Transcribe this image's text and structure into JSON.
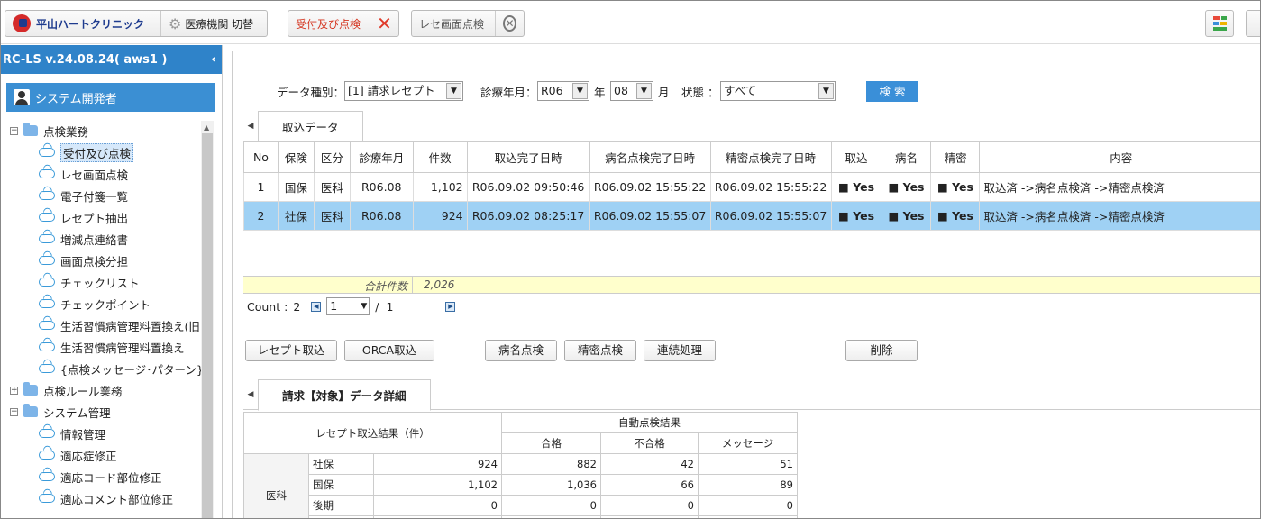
{
  "toolbar": {
    "clinic_name": "平山ハートクリニック",
    "switch_label": "医療機関 切替",
    "reception_label": "受付及び点検",
    "screen_check_label": "レセ画面点検"
  },
  "sidebar": {
    "version": "RC-LS v.24.08.24( aws1 )",
    "user": "システム開発者",
    "tree": [
      {
        "label": "点検業務",
        "type": "folder",
        "expander": "−",
        "level": 0
      },
      {
        "label": "受付及び点検",
        "type": "leaf",
        "level": 1,
        "selected": true
      },
      {
        "label": "レセ画面点検",
        "type": "leaf",
        "level": 1
      },
      {
        "label": "電子付箋一覧",
        "type": "leaf",
        "level": 1
      },
      {
        "label": "レセプト抽出",
        "type": "leaf",
        "level": 1
      },
      {
        "label": "増減点連絡書",
        "type": "leaf",
        "level": 1
      },
      {
        "label": "画面点検分担",
        "type": "leaf",
        "level": 1
      },
      {
        "label": "チェックリスト",
        "type": "leaf",
        "level": 1
      },
      {
        "label": "チェックポイント",
        "type": "leaf",
        "level": 1
      },
      {
        "label": "生活習慣病管理料置換え(旧.I",
        "type": "leaf",
        "level": 1
      },
      {
        "label": "生活習慣病管理料置換え",
        "type": "leaf",
        "level": 1
      },
      {
        "label": "{点検メッセージ･パターン}",
        "type": "leaf",
        "level": 1
      },
      {
        "label": "点検ルール業務",
        "type": "folder",
        "expander": "+",
        "level": 0
      },
      {
        "label": "システム管理",
        "type": "folder",
        "expander": "−",
        "level": 0
      },
      {
        "label": "情報管理",
        "type": "leaf",
        "level": 1
      },
      {
        "label": "適応症修正",
        "type": "leaf",
        "level": 1
      },
      {
        "label": "適応コード部位修正",
        "type": "leaf",
        "level": 1
      },
      {
        "label": "適応コメント部位修正",
        "type": "leaf",
        "level": 1
      }
    ]
  },
  "filter": {
    "data_type_label": "データ種別：",
    "data_type_value": "[1] 請求レセプト",
    "month_label": "診療年月：",
    "era_value": "R06",
    "year_suffix": "年",
    "month_value": "08",
    "month_suffix": "月",
    "status_label": "状態 ：",
    "status_value": "すべて",
    "search_button": "検 索"
  },
  "import_tab": {
    "label": "取込データ"
  },
  "grid": {
    "headers": [
      "No",
      "保険",
      "区分",
      "診療年月",
      "件数",
      "取込完了日時",
      "病名点検完了日時",
      "精密点検完了日時",
      "取込",
      "病名",
      "精密",
      "内容"
    ],
    "rows": [
      {
        "no": "1",
        "insurance": "国保",
        "category": "医科",
        "month": "R06.08",
        "count": "1,102",
        "import_done": "R06.09.02 09:50:46",
        "disease_done": "R06.09.02 15:55:22",
        "precise_done": "R06.09.02 15:55:22",
        "imp": "■ Yes",
        "dis": "■ Yes",
        "pre": "■ Yes",
        "content": "取込済 ->病名点検済 ->精密点検済",
        "selected": false
      },
      {
        "no": "2",
        "insurance": "社保",
        "category": "医科",
        "month": "R06.08",
        "count": "924",
        "import_done": "R06.09.02 08:25:17",
        "disease_done": "R06.09.02 15:55:07",
        "precise_done": "R06.09.02 15:55:07",
        "imp": "■ Yes",
        "dis": "■ Yes",
        "pre": "■ Yes",
        "content": "取込済 ->病名点検済 ->精密点検済",
        "selected": true
      }
    ],
    "total_label": "合計件数",
    "total_value": "2,026"
  },
  "pager": {
    "count_label": "Count :",
    "count_value": "2",
    "page_value": "1",
    "separator": "/",
    "page_total": "1"
  },
  "actions": {
    "receipt_import": "レセプト取込",
    "orca_import": "ORCA取込",
    "disease_check": "病名点検",
    "precise_check": "精密点検",
    "continuous": "連続処理",
    "delete": "削除"
  },
  "detail_tab": {
    "label": "請求【対象】データ詳細"
  },
  "detail": {
    "import_result_header": "レセプト取込結果（件）",
    "auto_check_header": "自動点検結果",
    "sub_headers": [
      "合格",
      "不合格",
      "メッセージ"
    ],
    "group": "医科",
    "rows": [
      {
        "label": "社保",
        "count": "924",
        "pass": "882",
        "fail": "42",
        "msg": "51"
      },
      {
        "label": "国保",
        "count": "1,102",
        "pass": "1,036",
        "fail": "66",
        "msg": "89"
      },
      {
        "label": "後期",
        "count": "0",
        "pass": "0",
        "fail": "0",
        "msg": "0"
      }
    ]
  },
  "colors": {
    "accent": "#2f83c9",
    "selected_row": "#9fd1f4",
    "total_bg": "#ffffcc"
  }
}
